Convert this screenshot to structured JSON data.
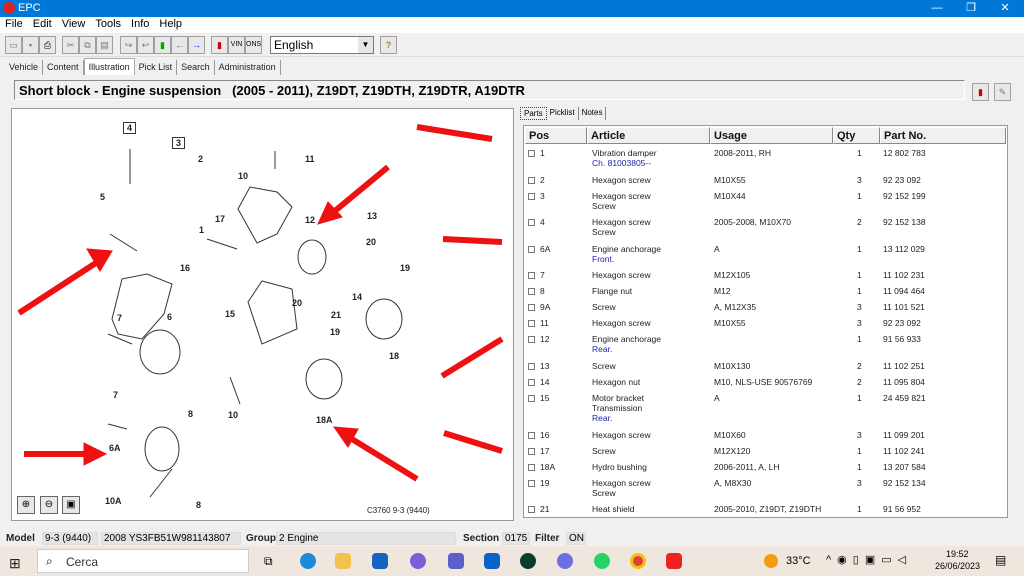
{
  "window": {
    "title": "EPC",
    "minimize": "—",
    "maximize": "❐",
    "close": "✕"
  },
  "menu": [
    "File",
    "Edit",
    "View",
    "Tools",
    "Info",
    "Help"
  ],
  "toolbar": {
    "language": "English",
    "vin_label": "VIN",
    "ons_label": "ONS",
    "help_icon": "help-icon"
  },
  "tabs": [
    {
      "label": "Vehicle"
    },
    {
      "label": "Content"
    },
    {
      "label": "Illustration",
      "active": true
    },
    {
      "label": "Pick List"
    },
    {
      "label": "Search"
    },
    {
      "label": "Administration"
    }
  ],
  "header": {
    "title": "Short block - Engine suspension   (2005 - 2011), Z19DT, Z19DTH, Z19DTR, A19DTR"
  },
  "illustration": {
    "callouts": [
      "4",
      "3",
      "2",
      "5",
      "1",
      "10",
      "11",
      "17",
      "12",
      "13",
      "20",
      "19",
      "16",
      "15",
      "14",
      "20",
      "21",
      "19",
      "18",
      "7",
      "6",
      "8",
      "10",
      "7",
      "6A",
      "10A",
      "8",
      "18A"
    ],
    "caption": "C3760 9-3 (9440)",
    "annotation_color": "#ee1111",
    "zoom_buttons": [
      "zoom-in",
      "zoom-out",
      "fit"
    ]
  },
  "parts_tabs": [
    "Parts",
    "Picklist",
    "Notes"
  ],
  "parts_table": {
    "columns": [
      "Pos",
      "Article",
      "Usage",
      "Qty",
      "Part No."
    ],
    "rows": [
      {
        "pos": "1",
        "article": [
          "Vibration damper"
        ],
        "note": "Ch. 81003805--",
        "usage": "2008-2011, RH",
        "qty": "1",
        "part": "12 802 783"
      },
      {
        "pos": "2",
        "article": [
          "Hexagon screw"
        ],
        "usage": "M10X55",
        "qty": "3",
        "part": "92 23 092"
      },
      {
        "pos": "3",
        "article": [
          "Hexagon screw",
          "Screw"
        ],
        "usage": "M10X44",
        "qty": "1",
        "part": "92 152 199"
      },
      {
        "pos": "4",
        "article": [
          "Hexagon screw",
          "Screw"
        ],
        "usage": "2005-2008, M10X70",
        "qty": "2",
        "part": "92 152 138"
      },
      {
        "pos": "6A",
        "article": [
          "Engine anchorage"
        ],
        "note": "Front.",
        "usage": "A",
        "qty": "1",
        "part": "13 112 029"
      },
      {
        "pos": "7",
        "article": [
          "Hexagon screw"
        ],
        "usage": "M12X105",
        "qty": "1",
        "part": "11 102 231"
      },
      {
        "pos": "8",
        "article": [
          "Flange nut"
        ],
        "usage": "M12",
        "qty": "1",
        "part": "11 094 464"
      },
      {
        "pos": "9A",
        "article": [
          "Screw"
        ],
        "usage": "A, M12X35",
        "qty": "3",
        "part": "11 101 521"
      },
      {
        "pos": "11",
        "article": [
          "Hexagon screw"
        ],
        "usage": "M10X55",
        "qty": "3",
        "part": "92 23 092"
      },
      {
        "pos": "12",
        "article": [
          "Engine anchorage"
        ],
        "note": "Rear.",
        "usage": "",
        "qty": "1",
        "part": "91 56 933"
      },
      {
        "pos": "13",
        "article": [
          "Screw"
        ],
        "usage": "M10X130",
        "qty": "2",
        "part": "11 102 251"
      },
      {
        "pos": "14",
        "article": [
          "Hexagon nut"
        ],
        "usage": "M10, NLS-USE 90576769",
        "qty": "2",
        "part": "11 095 804"
      },
      {
        "pos": "15",
        "article": [
          "Motor bracket",
          "Transmission"
        ],
        "note": "Rear.",
        "usage": "A",
        "qty": "1",
        "part": "24 459 821"
      },
      {
        "pos": "16",
        "article": [
          "Hexagon screw"
        ],
        "usage": "M10X60",
        "qty": "3",
        "part": "11 099 201"
      },
      {
        "pos": "17",
        "article": [
          "Screw"
        ],
        "usage": "M12X120",
        "qty": "1",
        "part": "11 102 241"
      },
      {
        "pos": "18A",
        "article": [
          "Hydro bushing"
        ],
        "usage": "2006-2011, A, LH",
        "qty": "1",
        "part": "13 207 584"
      },
      {
        "pos": "19",
        "article": [
          "Hexagon screw",
          "Screw"
        ],
        "usage": "A, M8X30",
        "qty": "3",
        "part": "92 152 134"
      },
      {
        "pos": "21",
        "article": [
          "Heat shield"
        ],
        "usage": "2005-2010, Z19DT, Z19DTH",
        "qty": "1",
        "part": "91 56 952"
      }
    ]
  },
  "status": {
    "model_label": "Model",
    "model": "9-3 (9440)",
    "vin": "2008 YS3FB51W981143807",
    "group_label": "Group",
    "group": "2 Engine",
    "section_label": "Section",
    "section": "0175",
    "filter_label": "Filter",
    "filter": "ON"
  },
  "taskbar": {
    "search_placeholder": "Cerca",
    "temperature": "33°C",
    "time": "19:52",
    "date": "26/06/2023"
  }
}
